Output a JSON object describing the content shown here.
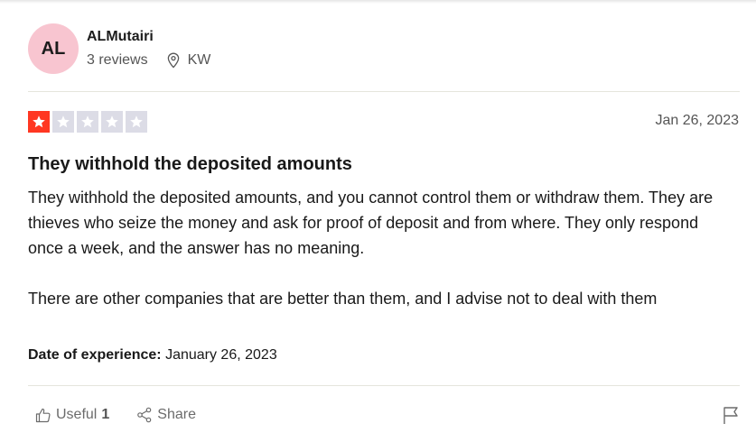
{
  "reviewer": {
    "initials": "AL",
    "name": "ALMutairi",
    "reviews": "3 reviews",
    "country": "KW",
    "avatar_color": "#f8c5d0"
  },
  "rating": {
    "stars": 1,
    "max": 5,
    "active_color": "#ff3722",
    "inactive_color": "#dcdce6"
  },
  "date": "Jan 26, 2023",
  "review": {
    "title": "They withhold the deposited amounts",
    "paragraphs": [
      "They withhold the deposited amounts, and you cannot control them or withdraw them. They are thieves who seize the money and ask for proof of deposit and from where. They only respond once a week, and the answer has no meaning.",
      "There are other companies that are better than them, and I advise not to deal with them"
    ]
  },
  "experience": {
    "label": "Date of experience:",
    "value": "January 26, 2023"
  },
  "actions": {
    "useful_label": "Useful",
    "useful_count": "1",
    "share_label": "Share"
  },
  "icons": {
    "location": "location-pin-icon",
    "useful": "thumbs-up-icon",
    "share": "share-icon",
    "report": "flag-icon",
    "star": "star-icon"
  }
}
